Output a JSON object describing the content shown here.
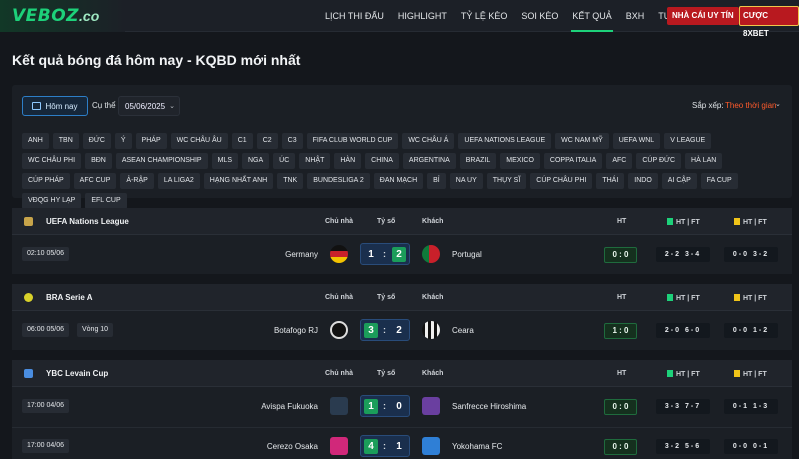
{
  "logo": {
    "main": "VEBOZ",
    "sub": ".co"
  },
  "nav": [
    "LỊCH THI ĐẤU",
    "HIGHLIGHT",
    "TỶ LỆ KÈO",
    "SOI KÈO",
    "KẾT QUẢ",
    "BXH",
    "TUYỂN DỤNG"
  ],
  "cta": {
    "primary": "NHÀ CÁI UY TÍN",
    "secondary": "CƯỢC 8XBET"
  },
  "page_title": "Kết quả bóng đá hôm nay - KQBD mới nhất",
  "filters": {
    "today_button": "Hôm nay",
    "date_label": "Cụ thể",
    "date_value": "05/06/2025",
    "sort_label": "Sắp xếp:",
    "sort_value": "Theo thời gian",
    "chips": [
      "ANH",
      "TBN",
      "ĐỨC",
      "Ý",
      "PHÁP",
      "WC CHÂU ÂU",
      "C1",
      "C2",
      "C3",
      "FIFA CLUB WORLD CUP",
      "WC CHÂU Á",
      "UEFA NATIONS LEAGUE",
      "WC NAM MỸ",
      "UEFA WNL",
      "V LEAGUE",
      "WC CHÂU PHI",
      "BĐN",
      "ASEAN CHAMPIONSHIP",
      "MLS",
      "NGA",
      "ÚC",
      "NHẬT",
      "HÀN",
      "CHINA",
      "ARGENTINA",
      "BRAZIL",
      "MEXICO",
      "COPPA ITALIA",
      "AFC",
      "CÚP ĐỨC",
      "HÀ LAN",
      "CÚP PHÁP",
      "AFC CUP",
      "Ả-RẬP",
      "LA LIGA2",
      "HẠNG NHẤT ANH",
      "TNK",
      "BUNDESLIGA 2",
      "ĐAN MẠCH",
      "BỈ",
      "NA UY",
      "THỤY SĨ",
      "CÚP CHÂU PHI",
      "THÁI",
      "INDO",
      "AI CẬP",
      "FA CUP",
      "VĐQG HY LẠP",
      "EFL CUP"
    ]
  },
  "headers": {
    "home": "Chủ nhà",
    "score": "Tỷ số",
    "away": "Khách",
    "ht": "HT",
    "corners": "HT | FT",
    "cards": "HT | FT"
  },
  "leagues": [
    {
      "name": "UEFA Nations League",
      "icon_color": "#c7a44a",
      "matches": [
        {
          "time": "02:10 05/06",
          "round": "",
          "home": "Germany",
          "home_score": "1",
          "away_score": "2",
          "away": "Portugal",
          "ht": "0 : 0",
          "corners": "2-2 3-4",
          "cards": "0-0 3-2",
          "home_crest": "#c9202a",
          "away_crest": "#0f7a3a"
        }
      ]
    },
    {
      "name": "BRA Serie A",
      "icon_color": "#d8d12a",
      "matches": [
        {
          "time": "06:00 05/06",
          "round": "Vòng 10",
          "home": "Botafogo RJ",
          "home_score": "3",
          "away_score": "2",
          "away": "Ceara",
          "ht": "1 : 0",
          "corners": "2-0 6-0",
          "cards": "0-0 1-2",
          "home_crest": "#1a1a1a",
          "away_crest": "#f0f0f0"
        }
      ]
    },
    {
      "name": "YBC Levain Cup",
      "icon_color": "#4a8de0",
      "matches": [
        {
          "time": "17:00 04/06",
          "round": "",
          "home": "Avispa Fukuoka",
          "home_score": "1",
          "away_score": "0",
          "away": "Sanfrecce Hiroshima",
          "ht": "0 : 0",
          "corners": "3-3 7-7",
          "cards": "0-1 1-3",
          "home_crest": "#2a3b4f",
          "away_crest": "#6a3fa0"
        },
        {
          "time": "17:00 04/06",
          "round": "",
          "home": "Cerezo Osaka",
          "home_score": "4",
          "away_score": "1",
          "away": "Yokohama FC",
          "ht": "0 : 0",
          "corners": "3-2 5-6",
          "cards": "0-0 0-1",
          "home_crest": "#d1287a",
          "away_crest": "#2f7fd6"
        }
      ]
    }
  ]
}
